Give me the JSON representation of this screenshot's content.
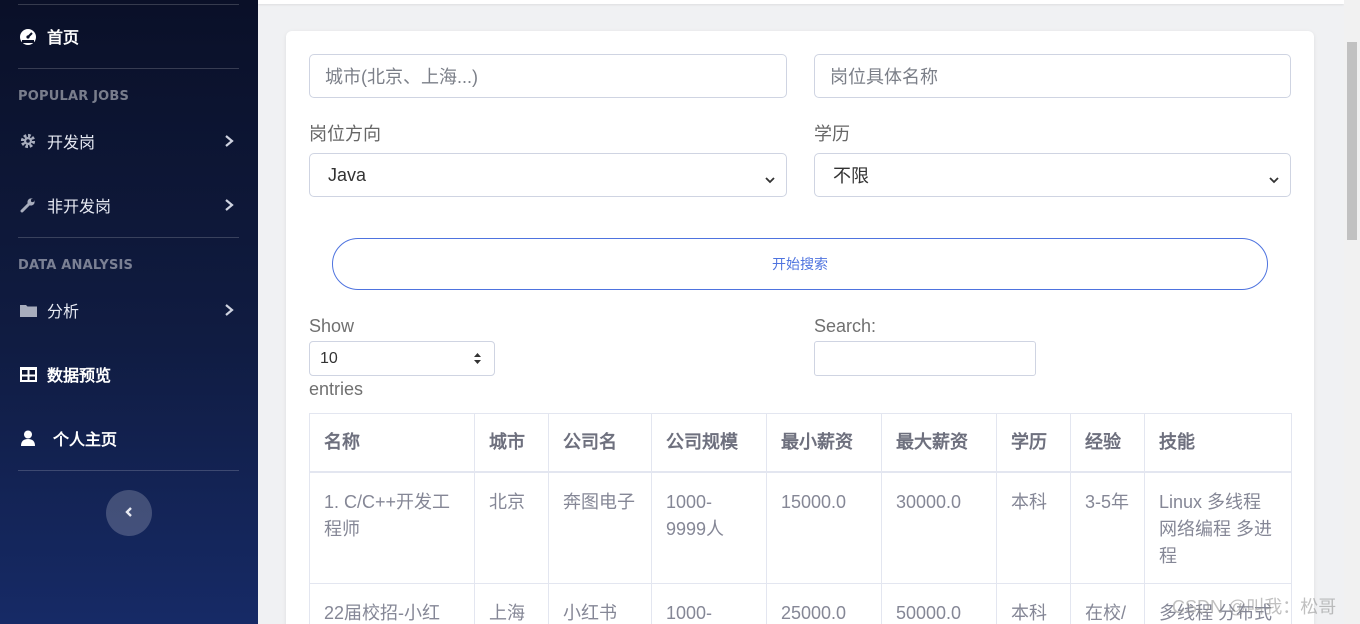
{
  "sidebar": {
    "home": "首页",
    "section1_heading": "POPULAR JOBS",
    "dev_jobs": "开发岗",
    "non_dev_jobs": "非开发岗",
    "section2_heading": "DATA ANALYSIS",
    "analysis": "分析",
    "data_preview": "数据预览",
    "profile": "个人主页"
  },
  "form": {
    "city_placeholder": "城市(北京、上海...)",
    "job_name_placeholder": "岗位具体名称",
    "direction_label": "岗位方向",
    "direction_value": "Java",
    "education_label": "学历",
    "education_value": "不限",
    "search_button": "开始搜索"
  },
  "datatable": {
    "show_label": "Show",
    "length_value": "10",
    "entries_label": "entries",
    "search_label": "Search:",
    "columns": [
      "名称",
      "城市",
      "公司名",
      "公司规模",
      "最小薪资",
      "最大薪资",
      "学历",
      "经验",
      "技能"
    ],
    "rows": [
      [
        "1. C/C++开发工程师",
        "北京",
        "奔图电子",
        "1000-9999人",
        "15000.0",
        "30000.0",
        "本科",
        "3-5年",
        "Linux 多线程 网络编程 多进程"
      ],
      [
        "22届校招-小红",
        "上海",
        "小红书",
        "1000-",
        "25000.0",
        "50000.0",
        "本科",
        "在校/",
        "多线程 分布式"
      ]
    ]
  },
  "watermark": "CSDN @叫我：松哥",
  "colors": {
    "accent": "#4e73df",
    "sidebar_top": "#0a1028",
    "sidebar_bottom": "#162a66"
  },
  "icons": {
    "home": "dashboard-icon",
    "dev": "gear-icon",
    "nondev": "wrench-icon",
    "analysis": "folder-icon",
    "preview": "table-icon",
    "profile": "user-icon"
  }
}
